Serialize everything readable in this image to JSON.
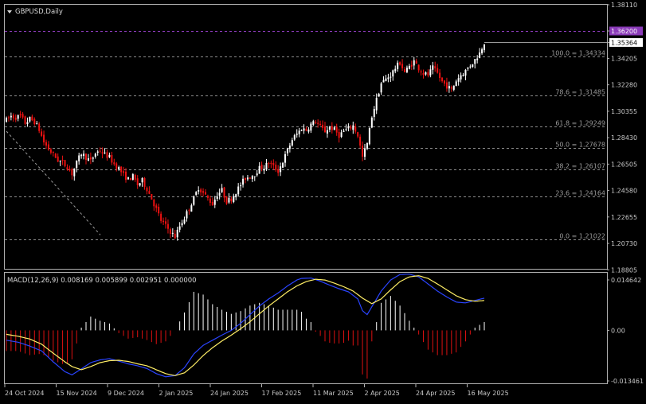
{
  "symbol_title": "GBPUSD,Daily",
  "macd_label": "MACD(12,26,9) 0.008169 0.005899 0.002951 0.000000",
  "colors": {
    "bull": "#ffffff",
    "bear": "#ee1111",
    "fib_line": "#8c8c8c",
    "tp_line": "#8a3ab8",
    "signal_line": "#ffee66",
    "macd_line": "#2a44ff",
    "hist_positive": "#ffffff",
    "hist_negative": "#dd1111",
    "grid": "#555555"
  },
  "chart_data": [
    {
      "type": "candlestick",
      "ylim": [
        1.1888,
        1.3811
      ],
      "price_axis_ticks": [
        "1.38110",
        "1.36200",
        "1.35364",
        "1.34205",
        "1.32280",
        "1.30355",
        "1.28430",
        "1.26505",
        "1.24580",
        "1.22655",
        "1.20730",
        "1.18805"
      ],
      "current_price": "1.35364",
      "target_level": "1.36200",
      "fib_levels": [
        {
          "text": "100.0 = 1.34334",
          "price": 1.34334
        },
        {
          "text": "78.6 = 1.31485",
          "price": 1.31485
        },
        {
          "text": "61.8 = 1.29249",
          "price": 1.29249
        },
        {
          "text": "50.0 = 1.27678",
          "price": 1.27678
        },
        {
          "text": "38.2 = 1.26107",
          "price": 1.26107
        },
        {
          "text": "23.6 = 1.24164",
          "price": 1.24164
        },
        {
          "text": "0.0 = 1.21022",
          "price": 1.21022
        }
      ],
      "x_labels": [
        "24 Oct 2024",
        "15 Nov 2024",
        "9 Dec 2024",
        "2 Jan 2025",
        "24 Jan 2025",
        "17 Feb 2025",
        "11 Mar 2025",
        "2 Apr 2025",
        "24 Apr 2025",
        "16 May 2025"
      ],
      "close_path": [
        [
          0,
          1.297
        ],
        [
          2,
          1.3
        ],
        [
          4,
          1.299
        ],
        [
          6,
          1.3
        ],
        [
          8,
          1.295
        ],
        [
          10,
          1.298
        ],
        [
          12,
          1.296
        ],
        [
          14,
          1.29
        ],
        [
          16,
          1.281
        ],
        [
          18,
          1.276
        ],
        [
          20,
          1.272
        ],
        [
          22,
          1.268
        ],
        [
          24,
          1.266
        ],
        [
          26,
          1.263
        ],
        [
          28,
          1.258
        ],
        [
          30,
          1.266
        ],
        [
          32,
          1.273
        ],
        [
          34,
          1.27
        ],
        [
          36,
          1.267
        ],
        [
          38,
          1.273
        ],
        [
          40,
          1.275
        ],
        [
          42,
          1.272
        ],
        [
          44,
          1.27
        ],
        [
          46,
          1.265
        ],
        [
          48,
          1.262
        ],
        [
          50,
          1.257
        ],
        [
          52,
          1.254
        ],
        [
          54,
          1.256
        ],
        [
          56,
          1.25
        ],
        [
          58,
          1.253
        ],
        [
          60,
          1.247
        ],
        [
          62,
          1.24
        ],
        [
          64,
          1.232
        ],
        [
          66,
          1.224
        ],
        [
          68,
          1.22
        ],
        [
          70,
          1.216
        ],
        [
          72,
          1.212
        ],
        [
          74,
          1.22
        ],
        [
          76,
          1.226
        ],
        [
          78,
          1.233
        ],
        [
          80,
          1.24
        ],
        [
          82,
          1.248
        ],
        [
          84,
          1.244
        ],
        [
          86,
          1.24
        ],
        [
          88,
          1.236
        ],
        [
          90,
          1.243
        ],
        [
          92,
          1.246
        ],
        [
          94,
          1.238
        ],
        [
          96,
          1.24
        ],
        [
          98,
          1.245
        ],
        [
          100,
          1.25
        ],
        [
          102,
          1.255
        ],
        [
          104,
          1.256
        ],
        [
          106,
          1.258
        ],
        [
          108,
          1.262
        ],
        [
          110,
          1.263
        ],
        [
          112,
          1.266
        ],
        [
          114,
          1.263
        ],
        [
          116,
          1.26
        ],
        [
          118,
          1.267
        ],
        [
          120,
          1.275
        ],
        [
          122,
          1.283
        ],
        [
          124,
          1.287
        ],
        [
          126,
          1.291
        ],
        [
          128,
          1.29
        ],
        [
          130,
          1.294
        ],
        [
          132,
          1.296
        ],
        [
          134,
          1.292
        ],
        [
          136,
          1.289
        ],
        [
          138,
          1.292
        ],
        [
          140,
          1.29
        ],
        [
          142,
          1.286
        ],
        [
          144,
          1.289
        ],
        [
          146,
          1.291
        ],
        [
          148,
          1.293
        ],
        [
          150,
          1.286
        ],
        [
          152,
          1.27
        ],
        [
          154,
          1.28
        ],
        [
          156,
          1.3
        ],
        [
          158,
          1.312
        ],
        [
          160,
          1.324
        ],
        [
          162,
          1.327
        ],
        [
          164,
          1.33
        ],
        [
          166,
          1.335
        ],
        [
          168,
          1.339
        ],
        [
          170,
          1.332
        ],
        [
          172,
          1.336
        ],
        [
          174,
          1.34
        ],
        [
          176,
          1.335
        ],
        [
          178,
          1.331
        ],
        [
          180,
          1.33
        ],
        [
          182,
          1.335
        ],
        [
          184,
          1.331
        ],
        [
          186,
          1.325
        ],
        [
          188,
          1.322
        ],
        [
          190,
          1.319
        ],
        [
          192,
          1.326
        ],
        [
          194,
          1.33
        ],
        [
          196,
          1.333
        ],
        [
          198,
          1.337
        ],
        [
          200,
          1.341
        ],
        [
          202,
          1.346
        ],
        [
          204,
          1.354
        ]
      ]
    },
    {
      "type": "macd",
      "ylim": [
        -0.013461,
        0.014642
      ],
      "axis_ticks": [
        "0.014642",
        "0.00",
        "-0.013461"
      ],
      "macd_line": [
        [
          0,
          -0.0025
        ],
        [
          5,
          -0.003
        ],
        [
          10,
          -0.004
        ],
        [
          15,
          -0.0052
        ],
        [
          20,
          -0.008
        ],
        [
          25,
          -0.0105
        ],
        [
          28,
          -0.0113
        ],
        [
          32,
          -0.0098
        ],
        [
          36,
          -0.0082
        ],
        [
          40,
          -0.0075
        ],
        [
          44,
          -0.0072
        ],
        [
          48,
          -0.0078
        ],
        [
          52,
          -0.0085
        ],
        [
          56,
          -0.009
        ],
        [
          60,
          -0.0097
        ],
        [
          64,
          -0.011
        ],
        [
          68,
          -0.0118
        ],
        [
          72,
          -0.0115
        ],
        [
          76,
          -0.0095
        ],
        [
          80,
          -0.006
        ],
        [
          84,
          -0.0038
        ],
        [
          88,
          -0.0025
        ],
        [
          92,
          -0.0012
        ],
        [
          96,
          0.0
        ],
        [
          100,
          0.0018
        ],
        [
          104,
          0.004
        ],
        [
          108,
          0.0062
        ],
        [
          112,
          0.008
        ],
        [
          116,
          0.0095
        ],
        [
          120,
          0.0113
        ],
        [
          124,
          0.0128
        ],
        [
          126,
          0.0132
        ],
        [
          130,
          0.0133
        ],
        [
          134,
          0.0125
        ],
        [
          138,
          0.0115
        ],
        [
          142,
          0.0106
        ],
        [
          146,
          0.0098
        ],
        [
          150,
          0.008
        ],
        [
          152,
          0.005
        ],
        [
          154,
          0.004
        ],
        [
          156,
          0.006
        ],
        [
          160,
          0.01
        ],
        [
          164,
          0.0128
        ],
        [
          168,
          0.0142
        ],
        [
          172,
          0.0143
        ],
        [
          176,
          0.0136
        ],
        [
          180,
          0.0118
        ],
        [
          184,
          0.01
        ],
        [
          188,
          0.0085
        ],
        [
          192,
          0.0072
        ],
        [
          196,
          0.007
        ],
        [
          200,
          0.0076
        ],
        [
          204,
          0.0082
        ]
      ],
      "signal_line": [
        [
          0,
          -0.001
        ],
        [
          5,
          -0.0015
        ],
        [
          10,
          -0.0022
        ],
        [
          15,
          -0.0035
        ],
        [
          20,
          -0.0058
        ],
        [
          25,
          -0.008
        ],
        [
          28,
          -0.0092
        ],
        [
          32,
          -0.01
        ],
        [
          36,
          -0.0092
        ],
        [
          40,
          -0.0082
        ],
        [
          44,
          -0.0077
        ],
        [
          48,
          -0.0076
        ],
        [
          52,
          -0.0079
        ],
        [
          56,
          -0.0085
        ],
        [
          60,
          -0.009
        ],
        [
          64,
          -0.01
        ],
        [
          68,
          -0.011
        ],
        [
          72,
          -0.0115
        ],
        [
          76,
          -0.0108
        ],
        [
          80,
          -0.0088
        ],
        [
          84,
          -0.0064
        ],
        [
          88,
          -0.0044
        ],
        [
          92,
          -0.0027
        ],
        [
          96,
          -0.0012
        ],
        [
          100,
          0.0004
        ],
        [
          104,
          0.0022
        ],
        [
          108,
          0.0042
        ],
        [
          112,
          0.0062
        ],
        [
          116,
          0.008
        ],
        [
          120,
          0.0098
        ],
        [
          124,
          0.0113
        ],
        [
          128,
          0.0124
        ],
        [
          132,
          0.013
        ],
        [
          136,
          0.0128
        ],
        [
          140,
          0.012
        ],
        [
          144,
          0.0111
        ],
        [
          148,
          0.01
        ],
        [
          152,
          0.0082
        ],
        [
          156,
          0.0068
        ],
        [
          160,
          0.008
        ],
        [
          164,
          0.0103
        ],
        [
          168,
          0.0124
        ],
        [
          172,
          0.0136
        ],
        [
          176,
          0.0139
        ],
        [
          180,
          0.0132
        ],
        [
          184,
          0.0118
        ],
        [
          188,
          0.0103
        ],
        [
          192,
          0.0088
        ],
        [
          196,
          0.0078
        ],
        [
          200,
          0.0074
        ],
        [
          204,
          0.0076
        ]
      ]
    }
  ]
}
